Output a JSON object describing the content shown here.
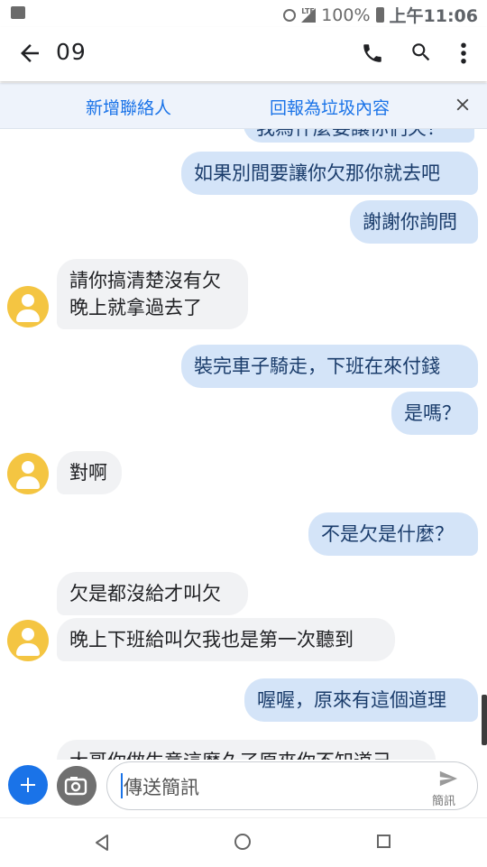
{
  "status_bar": {
    "battery": "100%",
    "network": "LTE",
    "time": "上午11:06"
  },
  "app_bar": {
    "title": "09"
  },
  "banner": {
    "add_contact": "新增聯絡人",
    "report_spam": "回報為垃圾內容"
  },
  "messages": [
    {
      "dir": "out",
      "text": "我為什麼要讓你們欠？"
    },
    {
      "dir": "out",
      "text": "如果別間要讓你欠那你就去吧"
    },
    {
      "dir": "out",
      "text": "謝謝你詢問"
    },
    {
      "dir": "in",
      "text_lines": [
        "請你搞清楚沒有欠",
        "晚上就拿過去了"
      ]
    },
    {
      "dir": "out",
      "text": "裝完車子騎走，下班在來付錢"
    },
    {
      "dir": "out",
      "text": "是嗎？"
    },
    {
      "dir": "in",
      "text": "對啊"
    },
    {
      "dir": "out",
      "text": "不是欠是什麼？"
    },
    {
      "dir": "in",
      "text": "欠是都沒給才叫欠"
    },
    {
      "dir": "in",
      "text": "晚上下班給叫欠我也是第一次聽到"
    },
    {
      "dir": "out",
      "text": "喔喔，原來有這個道理"
    },
    {
      "dir": "in",
      "text": "大哥你做生意這麼久了原來你不知道己"
    }
  ],
  "compose": {
    "placeholder": "傳送簡訊",
    "send_label": "簡訊"
  },
  "colors": {
    "accent": "#1a73e8",
    "outgoing_bubble": "#d4e4f8",
    "incoming_bubble": "#f1f2f4",
    "avatar": "#f4c542"
  },
  "icons": [
    "image-icon",
    "alarm-icon",
    "signal-icon",
    "battery-icon",
    "back-arrow-icon",
    "phone-icon",
    "search-icon",
    "more-vert-icon",
    "close-icon",
    "person-icon",
    "add-icon",
    "camera-icon",
    "send-icon",
    "nav-back-icon",
    "nav-home-icon",
    "nav-recents-icon"
  ]
}
